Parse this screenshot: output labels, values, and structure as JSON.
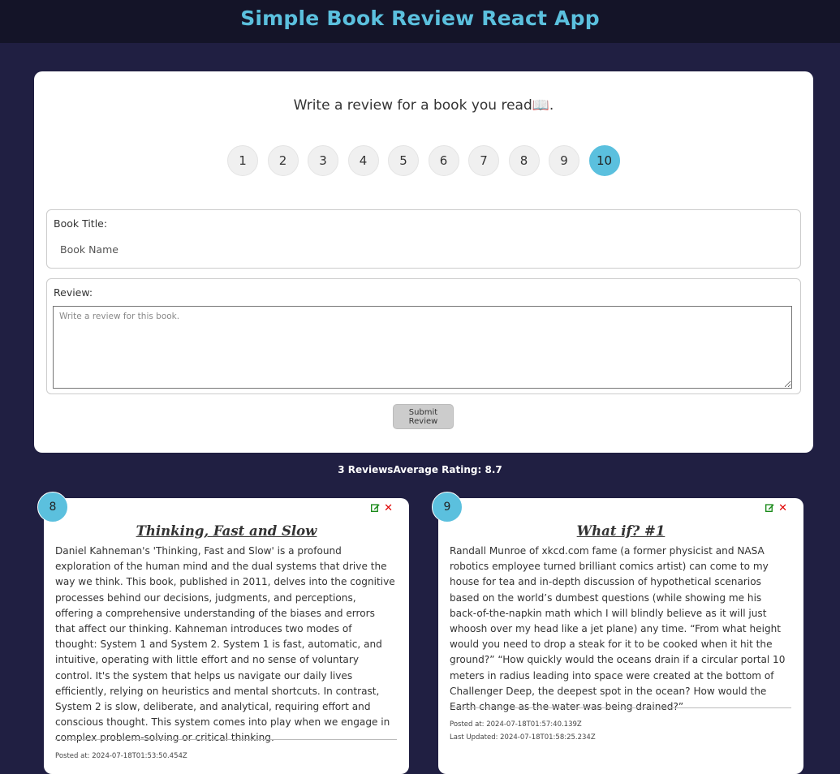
{
  "header": {
    "title": "Simple Book Review React App"
  },
  "form": {
    "heading": "Write a review for a book you read📖.",
    "ratings": [
      "1",
      "2",
      "3",
      "4",
      "5",
      "6",
      "7",
      "8",
      "9",
      "10"
    ],
    "selected_rating": "10",
    "title_label": "Book Title:",
    "title_placeholder": "Book Name",
    "review_label": "Review:",
    "review_placeholder": "Write a review for this book.",
    "submit_label": "Submit Review"
  },
  "summary": {
    "text": "3 ReviewsAverage Rating: 8.7"
  },
  "colors": {
    "accent": "#5bc0de",
    "background": "#201f42",
    "header_bg": "#141428",
    "edit": "#1a8a1a",
    "delete": "#e00000"
  },
  "reviews": [
    {
      "rating": "8",
      "title": "Thinking, Fast and Slow",
      "body": "Daniel Kahneman's 'Thinking, Fast and Slow' is a profound exploration of the human mind and the dual systems that drive the way we think. This book, published in 2011, delves into the cognitive processes behind our decisions, judgments, and perceptions, offering a comprehensive understanding of the biases and errors that affect our thinking. Kahneman introduces two modes of thought: System 1 and System 2. System 1 is fast, automatic, and intuitive, operating with little effort and no sense of voluntary control. It's the system that helps us navigate our daily lives efficiently, relying on heuristics and mental shortcuts. In contrast, System 2 is slow, deliberate, and analytical, requiring effort and conscious thought. This system comes into play when we engage in complex problem-solving or critical thinking.",
      "posted": "Posted at: 2024-07-18T01:53:50.454Z",
      "icons": [
        "edit-icon",
        "close-icon"
      ]
    },
    {
      "rating": "9",
      "title": "What if? #1",
      "body": "Randall Munroe of xkcd.com fame (a former physicist and NASA robotics employee turned brilliant comics artist) can come to my house for tea and in-depth discussion of hypothetical scenarios based on the world’s dumbest questions (while showing me his back-of-the-napkin math which I will blindly believe as it will just whoosh over my head like a jet plane) any time. “From what height would you need to drop a steak for it to be cooked when it hit the ground?” “How quickly would the oceans drain if a circular portal 10 meters in radius leading into space were created at the bottom of Challenger Deep, the deepest spot in the ocean? How would the Earth change as the water was being drained?”",
      "posted": "Posted at: 2024-07-18T01:57:40.139Z",
      "updated": "Last Updated: 2024-07-18T01:58:25.234Z",
      "icons": [
        "edit-icon",
        "close-icon"
      ]
    }
  ]
}
